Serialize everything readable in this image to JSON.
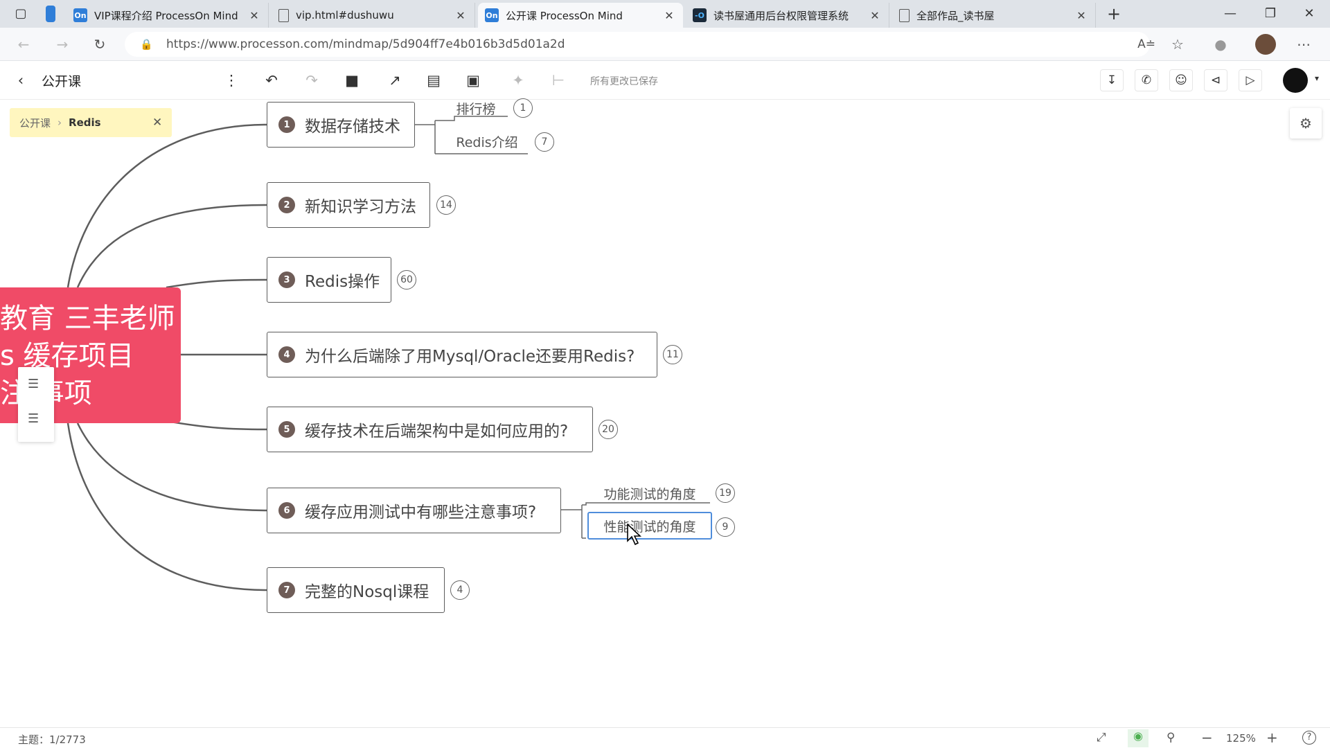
{
  "browser": {
    "tabs": [
      {
        "title": "VIP课程介绍 ProcessOn Mind",
        "favicon_text": "On",
        "favicon_color": "#2f7ed8",
        "active": false
      },
      {
        "title": "vip.html#dushuwu",
        "favicon_text": "",
        "favicon_color": "",
        "active": false
      },
      {
        "title": "公开课 ProcessOn Mind",
        "favicon_text": "On",
        "favicon_color": "#2f7ed8",
        "active": true
      },
      {
        "title": "读书屋通用后台权限管理系统",
        "favicon_text": "-O",
        "favicon_color": "#1b2a3a",
        "active": false
      },
      {
        "title": "全部作品_读书屋",
        "favicon_text": "",
        "favicon_color": "",
        "active": false
      }
    ],
    "url": "https://www.processon.com/mindmap/5d904ff7e4b016b3d5d01a2d"
  },
  "toolbar": {
    "back_title": "公开课",
    "save_status": "所有更改已保存"
  },
  "breadcrumb": {
    "parent": "公开课",
    "current": "Redis"
  },
  "mindmap": {
    "root_lines": [
      "教育 三丰老师",
      "s 缓存项目",
      "注  事项"
    ],
    "topics": [
      {
        "num": "1",
        "label": "数据存储技术",
        "count": ""
      },
      {
        "num": "2",
        "label": "新知识学习方法",
        "count": "14"
      },
      {
        "num": "3",
        "label": "Redis操作",
        "count": "60"
      },
      {
        "num": "4",
        "label": "为什么后端除了用Mysql/Oracle还要用Redis?",
        "count": "11"
      },
      {
        "num": "5",
        "label": "缓存技术在后端架构中是如何应用的?",
        "count": "20"
      },
      {
        "num": "6",
        "label": "缓存应用测试中有哪些注意事项?",
        "count": ""
      },
      {
        "num": "7",
        "label": "完整的Nosql课程",
        "count": "4"
      }
    ],
    "subtopics": [
      {
        "label": "排行榜",
        "count": "1"
      },
      {
        "label": "Redis介绍",
        "count": "7"
      },
      {
        "label": "功能测试的角度",
        "count": "19"
      },
      {
        "label": "性能测试的角度",
        "count": "9"
      }
    ]
  },
  "statusbar": {
    "topics_label": "主题：1/2773",
    "zoom": "125%"
  },
  "colors": {
    "root": "#f04b67",
    "breadcrumb_bg": "#fff6bf",
    "number_badge": "#6f5d58",
    "selection": "#4f8ddb"
  }
}
